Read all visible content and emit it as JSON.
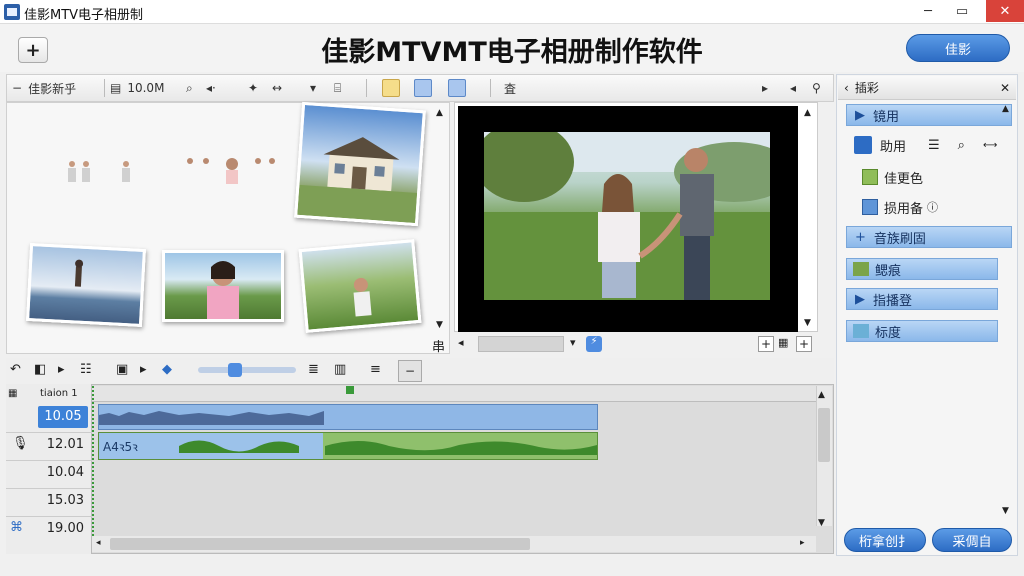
{
  "window": {
    "title": "佳影MTV电子相册制",
    "minimize": "─",
    "maximize": "▭",
    "close": "✕"
  },
  "header": {
    "add_label": "+",
    "title": "佳影MTVMT电子相册制作软件",
    "brand_button": "佳影"
  },
  "toolbar": {
    "view_label": "佳影新乎",
    "size_label": "10.0M",
    "misc": "査"
  },
  "right_panel": {
    "header": "插彩",
    "sections": [
      {
        "icon": "▶",
        "label": "镜用"
      },
      {
        "icon": "+",
        "label": "音族刷固"
      },
      {
        "icon": "▶",
        "label": "指播登"
      }
    ],
    "rows": [
      {
        "label": "助用"
      },
      {
        "label": "佳更色"
      },
      {
        "label": "损用备"
      },
      {
        "label": "鳃痕"
      },
      {
        "label": "标度"
      }
    ],
    "bottom_buttons": [
      "桁拿创扌",
      "采倜自"
    ]
  },
  "timeline": {
    "header_label": "tiaion 1",
    "times": [
      "10.05",
      "12.01",
      "10.04",
      "15.03",
      "19.00"
    ],
    "audio_clip_label": "A4ꝛ5ꝛ"
  },
  "preview": {
    "sub_label": "串"
  },
  "colors": {
    "accent": "#2d6cc4",
    "close": "#d9433a",
    "video_clip": "#8fb7e6",
    "audio_clip": "#8fc06c"
  }
}
